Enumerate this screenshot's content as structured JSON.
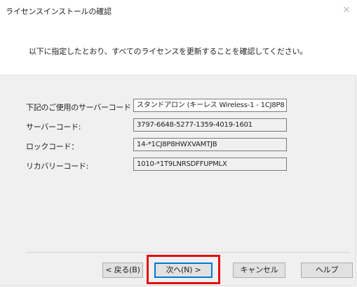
{
  "dialog": {
    "title": "ライセンスインストールの確認",
    "close_glyph": "×",
    "instruction": "以下に指定したとおり、すべてのライセンスを更新することを確認してください。"
  },
  "fields": [
    {
      "label": "下記のご使用のサーバーコード",
      "value": "スタンドアロン (キーレス Wireless-1 - 1CJ8P8"
    },
    {
      "label": "サーバーコード:",
      "value": "3797-6648-5277-1359-4019-1601"
    },
    {
      "label": "ロックコード：",
      "value": "14-*1CJ8P8HWXVAMTJB"
    },
    {
      "label": "リカバリーコード:",
      "value": "1010-*1T9LNRSDFFUPMLX"
    }
  ],
  "buttons": {
    "back": "< 戻る(B)",
    "next": "次へ(N) >",
    "cancel": "キャンセル",
    "help": "ヘルプ"
  },
  "colors": {
    "highlight": "#e01010",
    "default_button_border": "#0078d7"
  }
}
